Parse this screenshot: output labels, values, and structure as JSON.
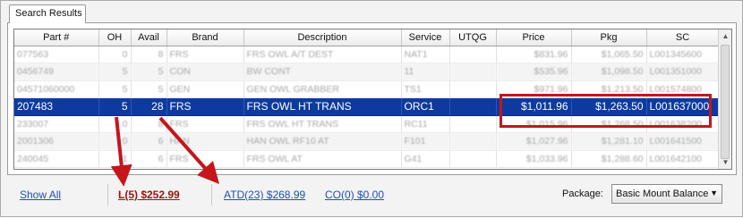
{
  "tab": {
    "label": "Search Results"
  },
  "columns": [
    "Part #",
    "OH",
    "Avail",
    "Brand",
    "Description",
    "Service",
    "UTQG",
    "Price",
    "Pkg",
    "SC"
  ],
  "rows": [
    {
      "part": "077563",
      "oh": "0",
      "avail": "8",
      "brand": "FRS",
      "desc": "FRS OWL A/T DEST",
      "service": "NAT1",
      "utqg": "",
      "price": "$831.96",
      "pkg": "$1,065.50",
      "sc": "L001345600",
      "selected": false
    },
    {
      "part": "0456749",
      "oh": "5",
      "avail": "5",
      "brand": "CON",
      "desc": "BW CONT",
      "service": "11",
      "utqg": "",
      "price": "$535.96",
      "pkg": "$1,098.50",
      "sc": "L001351000",
      "selected": false
    },
    {
      "part": "04571060000",
      "oh": "5",
      "avail": "5",
      "brand": "GEN",
      "desc": "GEN OWL GRABBER",
      "service": "TS1",
      "utqg": "",
      "price": "$971.96",
      "pkg": "$1,213.50",
      "sc": "L001574800",
      "selected": false
    },
    {
      "part": "207483",
      "oh": "5",
      "avail": "28",
      "brand": "FRS",
      "desc": "FRS OWL HT TRANS",
      "service": "ORC1",
      "utqg": "",
      "price": "$1,011.96",
      "pkg": "$1,263.50",
      "sc": "L001637000",
      "selected": true
    },
    {
      "part": "233007",
      "oh": "0",
      "avail": "8",
      "brand": "FRS",
      "desc": "FRS OWL HT TRANS",
      "service": "RC11",
      "utqg": "",
      "price": "$1,015.96",
      "pkg": "$1,268.50",
      "sc": "L001638200",
      "selected": false
    },
    {
      "part": "2001306",
      "oh": "0",
      "avail": "6",
      "brand": "HAN",
      "desc": "HAN OWL RF10 AT",
      "service": "F101",
      "utqg": "",
      "price": "$1,027.96",
      "pkg": "$1,281.10",
      "sc": "L001641500",
      "selected": false
    },
    {
      "part": "240045",
      "oh": "1",
      "avail": "6",
      "brand": "FRS",
      "desc": "FRS OWL AT",
      "service": "G41",
      "utqg": "",
      "price": "$1,033.96",
      "pkg": "$1,288.60",
      "sc": "L001642100",
      "selected": false
    }
  ],
  "footer": {
    "show_all": "Show All",
    "link_l": "L(5)  $252.99",
    "link_atd": "ATD(23)  $268.99",
    "link_co": "CO(0)  $0.00",
    "package_label": "Package:",
    "package_value": "Basic Mount Balance"
  },
  "icons": {
    "scroll_up": "scroll-up-arrow-icon",
    "scroll_down": "scroll-down-arrow-icon",
    "dropdown": "chevron-down-icon"
  },
  "colors": {
    "selection": "#0e3aa0",
    "annotation": "#c4161c",
    "link": "#1f4fb5",
    "active_link": "#9b1111"
  }
}
